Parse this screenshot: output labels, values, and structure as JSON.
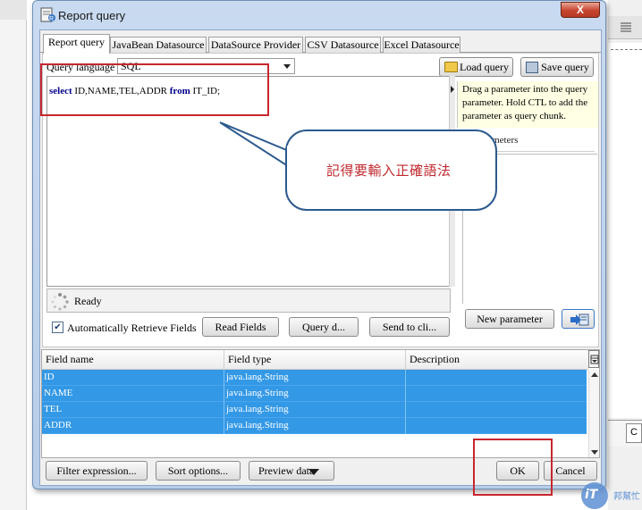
{
  "dialog": {
    "title": "Report query",
    "close_symbol": "X"
  },
  "tabs": [
    {
      "label": "Report query",
      "active": true
    },
    {
      "label": "JavaBean Datasource",
      "active": false
    },
    {
      "label": "DataSource Provider",
      "active": false
    },
    {
      "label": "CSV Datasource",
      "active": false
    },
    {
      "label": "Excel Datasource",
      "active": false
    }
  ],
  "query": {
    "language_label": "Query language",
    "language_value": "SQL",
    "load_query_label": "Load query",
    "save_query_label": "Save query",
    "sql_select": "select",
    "sql_fields": " ID,NAME,TEL,ADDR ",
    "sql_from": "from",
    "sql_table": " IT_ID;"
  },
  "status": {
    "text": "Ready"
  },
  "options": {
    "auto_retrieve_label": "Automatically Retrieve Fields",
    "auto_retrieve_checked": true,
    "read_fields_label": "Read Fields",
    "query_designer_label": "Query d...",
    "send_to_clipboard_label": "Send to cli..."
  },
  "parameters": {
    "hint": "Drag a parameter into the query parameter. Hold CTL to add the parameter as query chunk.",
    "available_label": "ble parameters",
    "new_parameter_label": "New parameter"
  },
  "fields_table": {
    "columns": [
      "Field name",
      "Field type",
      "Description"
    ],
    "rows": [
      {
        "name": "ID",
        "type": "java.lang.String",
        "description": ""
      },
      {
        "name": "NAME",
        "type": "java.lang.String",
        "description": ""
      },
      {
        "name": "TEL",
        "type": "java.lang.String",
        "description": ""
      },
      {
        "name": "ADDR",
        "type": "java.lang.String",
        "description": ""
      }
    ]
  },
  "footer": {
    "filter_expression_label": "Filter expression...",
    "sort_options_label": "Sort options...",
    "preview_data_label": "Preview data",
    "ok_label": "OK",
    "cancel_label": "Cancel"
  },
  "annotation": {
    "callout_text": "記得要輸入正確語法",
    "highlight_color": "#c8262e"
  },
  "background": {
    "right_panel_text": "C"
  },
  "watermark": {
    "logo_text": "iT",
    "sub_text": "邦幫忙"
  },
  "colors": {
    "selected_row": "#3398e6",
    "dialog_frame": "#b7cde8",
    "callout_text": "#c0292f",
    "sql_keyword": "#00008a"
  }
}
